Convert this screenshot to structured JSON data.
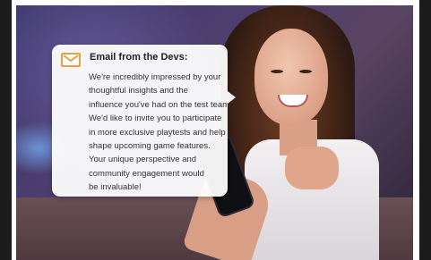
{
  "email": {
    "title": "Email from the Devs:",
    "icon": "envelope-icon",
    "accent_color": "#e8a040",
    "body_lines": [
      "We're incredibly impressed by your",
      "thoughtful insights and the",
      "influence you've had on the test team",
      "We'd like to invite you to participate",
      "in more exclusive playtests and help",
      "shape upcoming game features.",
      "Your unique perspective and",
      "community engagement would",
      "be invaluable!"
    ]
  }
}
